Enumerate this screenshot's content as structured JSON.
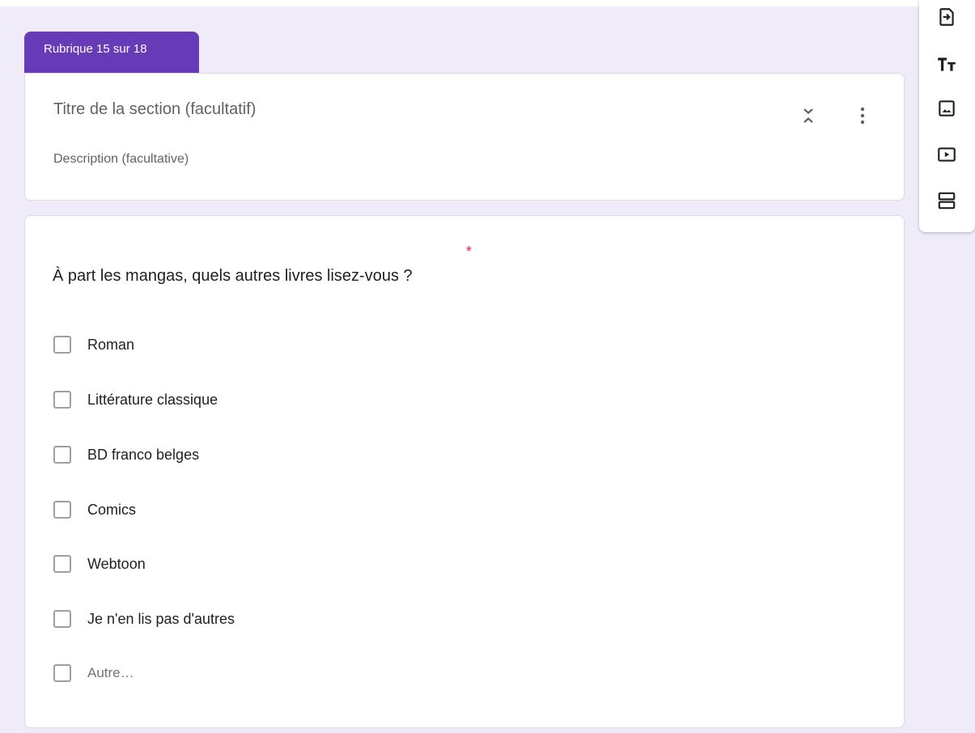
{
  "section": {
    "tab_label": "Rubrique 15 sur 18",
    "title_placeholder": "Titre de la section (facultatif)",
    "description_placeholder": "Description (facultative)"
  },
  "question": {
    "title": "À part les mangas, quels autres livres lisez-vous ?",
    "required_marker": "*",
    "options": [
      {
        "label": "Roman"
      },
      {
        "label": "Littérature classique"
      },
      {
        "label": "BD franco belges"
      },
      {
        "label": "Comics"
      },
      {
        "label": "Webtoon"
      },
      {
        "label": "Je n'en lis pas d'autres"
      }
    ],
    "other_option": "Autre…"
  },
  "toolbar": {
    "items": [
      {
        "icon": "import-questions-icon"
      },
      {
        "icon": "add-title-description-icon"
      },
      {
        "icon": "add-image-icon"
      },
      {
        "icon": "add-video-icon"
      },
      {
        "icon": "add-section-icon"
      }
    ]
  },
  "colors": {
    "accent": "#673ab7",
    "background": "#efebf8",
    "required": "#d93025"
  }
}
